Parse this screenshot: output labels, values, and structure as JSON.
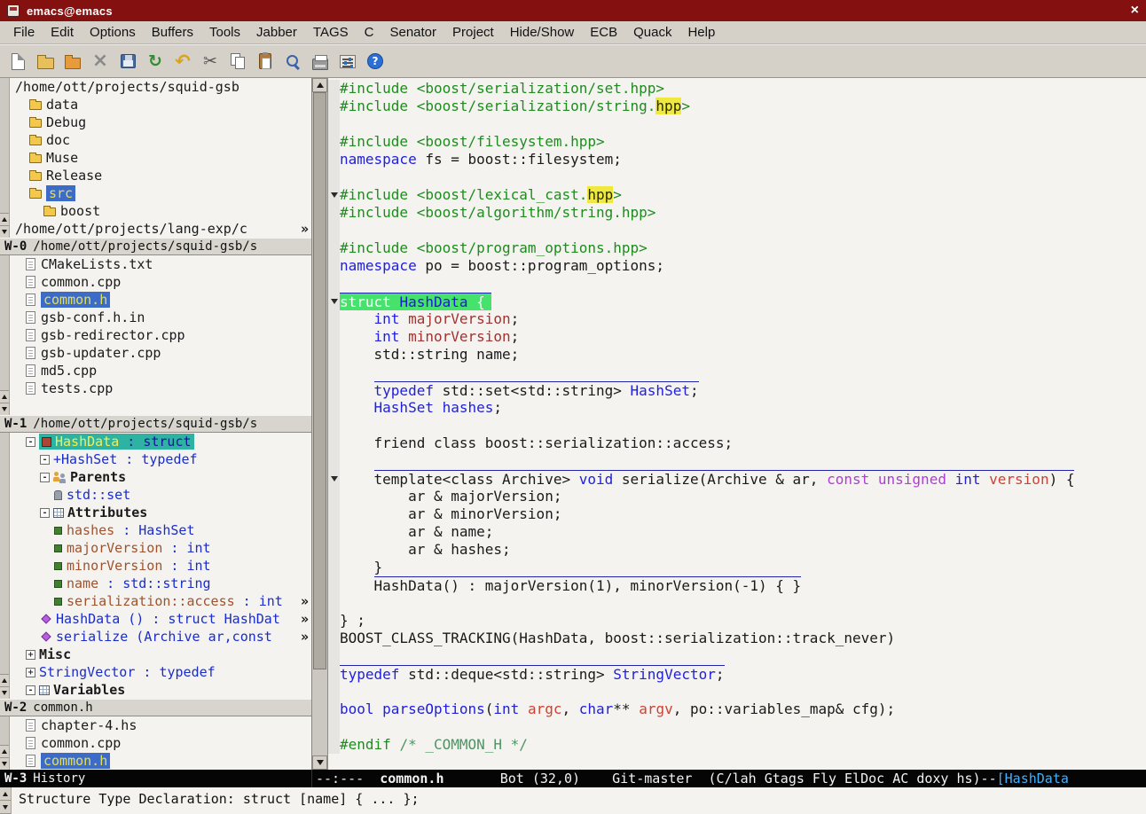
{
  "colors": {
    "title-bg": "#841010",
    "sel-bg": "#3c6bc8",
    "sel-fg": "#e4e054",
    "mhl-bg": "#2eb3a2",
    "struct-bg": "#45e36b",
    "hl-bg": "#efe93f",
    "kw": "#2020dd",
    "pp": "#1e8c1e",
    "var": "#a03232",
    "cst": "#b13cd6",
    "arg": "#ce4233",
    "cmt": "#4f9464",
    "ovl": "#2222aa",
    "ml-bg": "#050505",
    "ml-tag": "#41b0ff"
  },
  "window": {
    "title": "emacs@emacs",
    "close_label": "×"
  },
  "menubar": [
    "File",
    "Edit",
    "Options",
    "Buffers",
    "Tools",
    "Jabber",
    "TAGS",
    "C",
    "Senator",
    "Project",
    "Hide/Show",
    "ECB",
    "Quack",
    "Help"
  ],
  "toolbar": [
    "new-file",
    "open-folder",
    "dired-folder",
    "close-buffer",
    "save",
    "revert",
    "undo",
    "cut",
    "copy",
    "paste",
    "search",
    "print",
    "preferences",
    "help"
  ],
  "ecb": {
    "bars": {
      "w0": {
        "tag": "W-0",
        "title": "/home/ott/projects/squid-gsb/s"
      },
      "w1": {
        "tag": "W-1",
        "title": "/home/ott/projects/squid-gsb/s"
      },
      "w2": {
        "tag": "W-2",
        "title": "common.h"
      },
      "w3": {
        "tag": "W-3",
        "title": "History"
      }
    },
    "directories": [
      {
        "label": "/home/ott/projects/squid-gsb",
        "indent": 0
      },
      {
        "label": "data",
        "icon": "folder",
        "indent": 1
      },
      {
        "label": "Debug",
        "icon": "folder",
        "indent": 1
      },
      {
        "label": "doc",
        "icon": "folder",
        "indent": 1
      },
      {
        "label": "Muse",
        "icon": "folder",
        "indent": 1
      },
      {
        "label": "Release",
        "icon": "folder",
        "indent": 1
      },
      {
        "label": "src",
        "icon": "folder",
        "indent": 1,
        "selected": true
      },
      {
        "label": "boost",
        "icon": "folder",
        "indent": 2
      },
      {
        "label": "/home/ott/projects/lang-exp/c",
        "indent": 0,
        "truncated": true
      }
    ],
    "sources": [
      {
        "label": "CMakeLists.txt",
        "icon": "file"
      },
      {
        "label": "common.cpp",
        "icon": "file"
      },
      {
        "label": "common.h",
        "icon": "file",
        "selected": true
      },
      {
        "label": "gsb-conf.h.in",
        "icon": "file"
      },
      {
        "label": "gsb-redirector.cpp",
        "icon": "file"
      },
      {
        "label": "gsb-updater.cpp",
        "icon": "file"
      },
      {
        "label": "md5.cpp",
        "icon": "file"
      },
      {
        "label": "tests.cpp",
        "icon": "file"
      }
    ],
    "methods": [
      {
        "indent": 0,
        "box": "-",
        "icon": "struct",
        "selected": true,
        "segs": [
          {
            "t": "HashData",
            "c": "m-name-sel"
          },
          {
            "t": " : struct",
            "c": "m-type-sel"
          }
        ]
      },
      {
        "indent": 1,
        "box": "-",
        "segs": [
          {
            "t": "+HashSet : typedef",
            "c": "m-blue"
          }
        ]
      },
      {
        "indent": 1,
        "box": "-",
        "icon": "parents",
        "segs": [
          {
            "t": "Parents",
            "c": "m-bold"
          }
        ]
      },
      {
        "indent": 2,
        "icon": "member",
        "segs": [
          {
            "t": "std::set",
            "c": "m-blue"
          }
        ]
      },
      {
        "indent": 1,
        "box": "-",
        "icon": "grid",
        "segs": [
          {
            "t": "Attributes",
            "c": "m-bold"
          }
        ]
      },
      {
        "indent": 2,
        "icon": "attr",
        "segs": [
          {
            "t": "hashes",
            "c": "m-attr"
          },
          {
            "t": " : HashSet",
            "c": "m-blue"
          }
        ]
      },
      {
        "indent": 2,
        "icon": "attr",
        "segs": [
          {
            "t": "majorVersion",
            "c": "m-attr"
          },
          {
            "t": " : int",
            "c": "m-blue"
          }
        ]
      },
      {
        "indent": 2,
        "icon": "attr",
        "segs": [
          {
            "t": "minorVersion",
            "c": "m-attr"
          },
          {
            "t": " : int",
            "c": "m-blue"
          }
        ]
      },
      {
        "indent": 2,
        "icon": "attr",
        "segs": [
          {
            "t": "name",
            "c": "m-attr"
          },
          {
            "t": " : std::string",
            "c": "m-blue"
          }
        ]
      },
      {
        "indent": 2,
        "icon": "attr",
        "truncated": true,
        "segs": [
          {
            "t": "serialization::access",
            "c": "m-attr"
          },
          {
            "t": " : int",
            "c": "m-blue"
          }
        ]
      },
      {
        "indent": 1,
        "icon": "method",
        "truncated": true,
        "segs": [
          {
            "t": "HashData () : struct HashDat",
            "c": "m-blue"
          }
        ]
      },
      {
        "indent": 1,
        "icon": "method",
        "truncated": true,
        "segs": [
          {
            "t": "serialize (Archive ar,const ",
            "c": "m-blue"
          }
        ]
      },
      {
        "indent": 0,
        "box": "+",
        "segs": [
          {
            "t": "Misc",
            "c": "m-bold"
          }
        ]
      },
      {
        "indent": 0,
        "box": "+",
        "segs": [
          {
            "t": "StringVector : typedef",
            "c": "m-blue"
          }
        ]
      },
      {
        "indent": 0,
        "box": "-",
        "icon": "grid",
        "segs": [
          {
            "t": "Variables",
            "c": "m-bold"
          }
        ]
      }
    ],
    "history": [
      {
        "label": "chapter-4.hs",
        "icon": "file"
      },
      {
        "label": "common.cpp",
        "icon": "file"
      },
      {
        "label": "common.h",
        "icon": "file",
        "selected": true
      }
    ]
  },
  "editor": {
    "lines": [
      {
        "tokens": [
          {
            "t": "#include <boost/serialization/set.hpp>",
            "c": "pp"
          }
        ]
      },
      {
        "tokens": [
          {
            "t": "#include <boost/serialization/string.",
            "c": "pp"
          },
          {
            "t": "hpp",
            "c": "pp hl"
          },
          {
            "t": ">",
            "c": "pp"
          }
        ]
      },
      {
        "tokens": []
      },
      {
        "tokens": [
          {
            "t": "#include <boost/filesystem.hpp>",
            "c": "pp"
          }
        ]
      },
      {
        "tokens": [
          {
            "t": "namespace",
            "c": "kw"
          },
          {
            "t": " fs = boost::filesystem;"
          }
        ]
      },
      {
        "tokens": []
      },
      {
        "fringe": true,
        "tokens": [
          {
            "t": "#include <boost/lexical_cast.",
            "c": "pp"
          },
          {
            "t": "hpp",
            "c": "pp hl"
          },
          {
            "t": ">",
            "c": "pp"
          }
        ]
      },
      {
        "tokens": [
          {
            "t": "#include <boost/algorithm/string.hpp>",
            "c": "pp"
          }
        ]
      },
      {
        "tokens": []
      },
      {
        "tokens": [
          {
            "t": "#include <boost/program_options.hpp>",
            "c": "pp"
          }
        ]
      },
      {
        "tokens": [
          {
            "t": "namespace",
            "c": "kw"
          },
          {
            "t": " po = boost::program_options;"
          }
        ]
      },
      {
        "tokens": []
      },
      {
        "fringe": true,
        "overline": true,
        "highlight": true,
        "tokens": [
          {
            "t": "struct ",
            "c": "hlw"
          },
          {
            "t": "HashData",
            "c": "hln"
          },
          {
            "t": " {",
            "c": "hlw"
          }
        ]
      },
      {
        "indent": "    ",
        "tokens": [
          {
            "t": "int",
            "c": "kw"
          },
          {
            "t": " "
          },
          {
            "t": "majorVersion",
            "c": "var"
          },
          {
            "t": ";"
          }
        ]
      },
      {
        "indent": "    ",
        "tokens": [
          {
            "t": "int",
            "c": "kw"
          },
          {
            "t": " "
          },
          {
            "t": "minorVersion",
            "c": "var"
          },
          {
            "t": ";"
          }
        ]
      },
      {
        "indent": "    ",
        "tokens": [
          {
            "t": "std::string name;"
          }
        ]
      },
      {
        "tokens": []
      },
      {
        "indent": "    ",
        "overline": true,
        "tokens": [
          {
            "t": "typedef",
            "c": "kw"
          },
          {
            "t": " std::set<std::string> "
          },
          {
            "t": "HashSet",
            "c": "type"
          },
          {
            "t": ";"
          }
        ]
      },
      {
        "indent": "    ",
        "tokens": [
          {
            "t": "HashSet",
            "c": "type"
          },
          {
            "t": " "
          },
          {
            "t": "hashes",
            "c": "type"
          },
          {
            "t": ";"
          }
        ]
      },
      {
        "tokens": []
      },
      {
        "indent": "    ",
        "tokens": [
          {
            "t": "friend class boost::serialization::access;"
          }
        ]
      },
      {
        "tokens": []
      },
      {
        "indent": "    ",
        "overline": true,
        "fringe": true,
        "tokens": [
          {
            "t": "template<class Archive> "
          },
          {
            "t": "void",
            "c": "kw"
          },
          {
            "t": " serialize(Archive & ar, "
          },
          {
            "t": "const",
            "c": "cst"
          },
          {
            "t": " "
          },
          {
            "t": "unsigned",
            "c": "cst"
          },
          {
            "t": " "
          },
          {
            "t": "int",
            "c": "kw"
          },
          {
            "t": " "
          },
          {
            "t": "version",
            "c": "arg"
          },
          {
            "t": ") {"
          }
        ]
      },
      {
        "indent": "        ",
        "tokens": [
          {
            "t": "ar & majorVersion;"
          }
        ]
      },
      {
        "indent": "        ",
        "tokens": [
          {
            "t": "ar & minorVersion;"
          }
        ]
      },
      {
        "indent": "        ",
        "tokens": [
          {
            "t": "ar & name;"
          }
        ]
      },
      {
        "indent": "        ",
        "tokens": [
          {
            "t": "ar & hashes;"
          }
        ]
      },
      {
        "indent": "    ",
        "tokens": [
          {
            "t": "}"
          }
        ]
      },
      {
        "indent": "    ",
        "overline": true,
        "tokens": [
          {
            "t": "HashData() : majorVersion(1), minorVersion(-1) { }"
          }
        ]
      },
      {
        "tokens": []
      },
      {
        "tokens": [
          {
            "t": "} ;"
          }
        ]
      },
      {
        "tokens": [
          {
            "t": "BOOST_CLASS_TRACKING(HashData, boost::serialization::track_never)"
          }
        ]
      },
      {
        "tokens": []
      },
      {
        "overline": true,
        "tokens": [
          {
            "t": "typedef",
            "c": "kw"
          },
          {
            "t": " std::deque<std::string> "
          },
          {
            "t": "StringVector",
            "c": "type"
          },
          {
            "t": ";"
          }
        ]
      },
      {
        "tokens": []
      },
      {
        "tokens": [
          {
            "t": "bool",
            "c": "kw"
          },
          {
            "t": " "
          },
          {
            "t": "parseOptions",
            "c": "fn"
          },
          {
            "t": "("
          },
          {
            "t": "int",
            "c": "kw"
          },
          {
            "t": " "
          },
          {
            "t": "argc",
            "c": "arg"
          },
          {
            "t": ", "
          },
          {
            "t": "char",
            "c": "kw"
          },
          {
            "t": "** "
          },
          {
            "t": "argv",
            "c": "arg"
          },
          {
            "t": ", po::variables_map& cfg);"
          }
        ]
      },
      {
        "tokens": []
      },
      {
        "tokens": [
          {
            "t": "#endif",
            "c": "pp"
          },
          {
            "t": " "
          },
          {
            "t": "/* _COMMON_H */",
            "c": "cmt"
          }
        ]
      }
    ]
  },
  "modeline": {
    "segments": [
      {
        "t": "--:---  "
      },
      {
        "t": "common.h",
        "c": "ml-buffer"
      },
      {
        "t": "       Bot (32,0)    Git-master  (C/lah Gtags Fly ElDoc AC doxy hs)--"
      },
      {
        "t": "[HashData",
        "c": "ml-tag"
      }
    ]
  },
  "minibuffer": {
    "text": "Structure Type Declaration: struct [name] { ... };"
  }
}
